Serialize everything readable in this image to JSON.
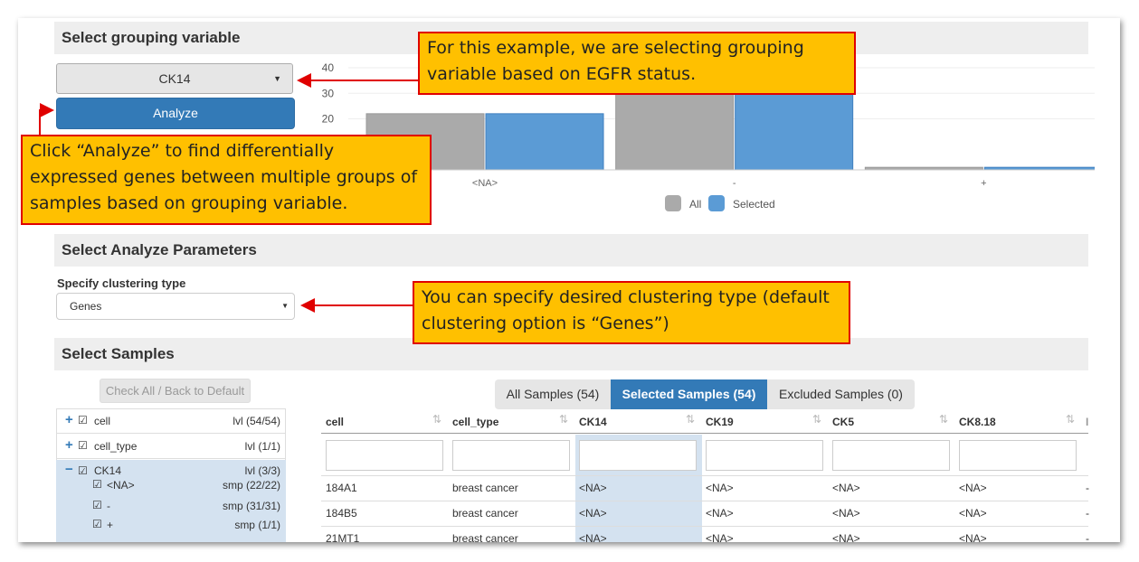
{
  "sections": {
    "grouping": "Select grouping variable",
    "analyze_params": "Select Analyze Parameters",
    "samples": "Select Samples"
  },
  "grouping": {
    "selected": "CK14",
    "analyze_label": "Analyze"
  },
  "chart_data": {
    "type": "bar",
    "categories": [
      "<NA>",
      "-",
      "+"
    ],
    "series": [
      {
        "name": "All",
        "values": [
          22,
          31,
          1
        ],
        "color": "#aaaaaa"
      },
      {
        "name": "Selected",
        "values": [
          22,
          31,
          1
        ],
        "color": "#5b9bd5"
      }
    ],
    "y_ticks": [
      "20",
      "30",
      "40"
    ],
    "ylim": [
      0,
      40
    ],
    "legend_position": "bottom"
  },
  "callouts": {
    "grouping": "For this example, we are selecting grouping variable based on EGFR status.",
    "analyze": "Click “Analyze” to find differentially expressed genes between multiple groups of samples based on grouping variable.",
    "clustering": "You can specify desired clustering type (default clustering option is “Genes”)"
  },
  "params": {
    "clustering_label": "Specify clustering type",
    "clustering_value": "Genes"
  },
  "samples": {
    "check_all_label": "Check All / Back to Default",
    "tree": [
      {
        "name": "cell",
        "count": "lvl (54/54)"
      },
      {
        "name": "cell_type",
        "count": "lvl (1/1)"
      },
      {
        "name": "CK14",
        "count": "lvl (3/3)",
        "children": [
          {
            "name": "<NA>",
            "count": "smp (22/22)"
          },
          {
            "name": "-",
            "count": "smp (31/31)"
          },
          {
            "name": "+",
            "count": "smp (1/1)"
          }
        ]
      }
    ],
    "tabs": [
      {
        "label": "All Samples (54)"
      },
      {
        "label": "Selected Samples (54)"
      },
      {
        "label": "Excluded Samples (0)"
      }
    ],
    "columns": [
      "cell",
      "cell_type",
      "CK14",
      "CK19",
      "CK5",
      "CK8.18",
      "I"
    ],
    "rows": [
      [
        "184A1",
        "breast cancer",
        "<NA>",
        "<NA>",
        "<NA>",
        "<NA>",
        "-"
      ],
      [
        "184B5",
        "breast cancer",
        "<NA>",
        "<NA>",
        "<NA>",
        "<NA>",
        "-"
      ],
      [
        "21MT1",
        "breast cancer",
        "<NA>",
        "<NA>",
        "<NA>",
        "<NA>",
        "-"
      ]
    ]
  }
}
